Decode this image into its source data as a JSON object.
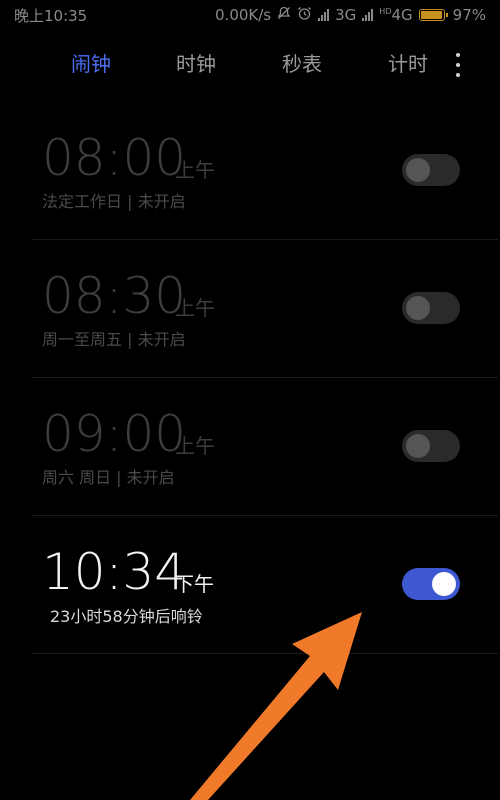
{
  "status_bar": {
    "time": "晚上10:35",
    "net_speed": "0.00K/s",
    "mute_icon": "bell-off-icon",
    "alarm_icon": "alarm-clock-icon",
    "network_1": "3G",
    "network_2_badge": "HD",
    "network_2": "4G",
    "battery_percent": "97%"
  },
  "tabs": [
    {
      "label": "闹钟",
      "active": true
    },
    {
      "label": "时钟",
      "active": false
    },
    {
      "label": "秒表",
      "active": false
    },
    {
      "label": "计时",
      "active": false
    }
  ],
  "more_icon": "more-vertical-icon",
  "alarms": [
    {
      "time": "08:00",
      "ampm": "上午",
      "detail": "法定工作日 | 未开启",
      "enabled": false
    },
    {
      "time": "08:30",
      "ampm": "上午",
      "detail": "周一至周五 | 未开启",
      "enabled": false
    },
    {
      "time": "09:00",
      "ampm": "上午",
      "detail": "周六 周日 | 未开启",
      "enabled": false
    },
    {
      "time": "10:34",
      "ampm": "下午",
      "detail": "23小时58分钟后响铃",
      "enabled": true
    }
  ],
  "colors": {
    "accent": "#4c6df0",
    "toggle_on": "#3e58d2",
    "arrow": "#f07a2a",
    "battery": "#c8901f"
  },
  "annotation_icon": "orange-arrow-pointer"
}
